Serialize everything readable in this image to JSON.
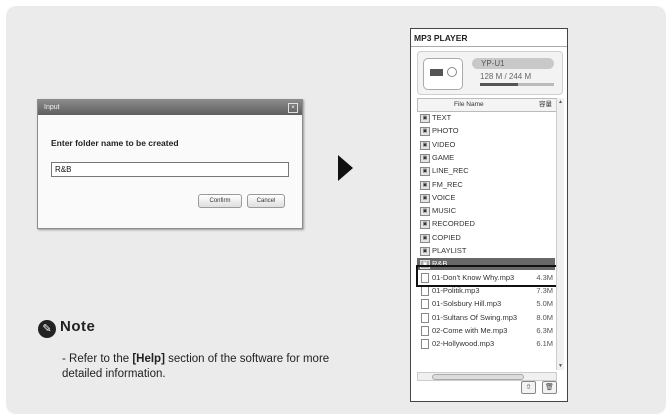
{
  "dialog": {
    "title": "Input",
    "close_label": "×",
    "prompt": "Enter folder name to be created",
    "input_value": "R&B",
    "confirm_label": "Confirm",
    "cancel_label": "Cancel"
  },
  "note": {
    "title": "Note",
    "icon": "pencil-note-icon",
    "text_prefix": "- Refer to the ",
    "text_bold": "[Help]",
    "text_suffix": " section of the software for more detailed information."
  },
  "player": {
    "title": "MP3 PLAYER",
    "device_name": "YP-U1",
    "capacity": "128 M / 244 M",
    "usage_fraction": 0.52,
    "col_name": "File Name",
    "col_size": "容量",
    "rows": [
      {
        "type": "folder",
        "name": "TEXT",
        "size": ""
      },
      {
        "type": "folder",
        "name": "PHOTO",
        "size": ""
      },
      {
        "type": "folder",
        "name": "VIDEO",
        "size": ""
      },
      {
        "type": "folder",
        "name": "GAME",
        "size": ""
      },
      {
        "type": "folder",
        "name": "LINE_REC",
        "size": ""
      },
      {
        "type": "folder",
        "name": "FM_REC",
        "size": ""
      },
      {
        "type": "folder",
        "name": "VOICE",
        "size": ""
      },
      {
        "type": "folder",
        "name": "MUSIC",
        "size": ""
      },
      {
        "type": "folder",
        "name": "RECORDED",
        "size": ""
      },
      {
        "type": "folder",
        "name": "COPIED",
        "size": ""
      },
      {
        "type": "folder",
        "name": "PLAYLIST",
        "size": ""
      },
      {
        "type": "folder",
        "name": "R&B",
        "size": "",
        "selected": true
      },
      {
        "type": "file",
        "name": "01-Don't Know Why.mp3",
        "size": "4.3M"
      },
      {
        "type": "file",
        "name": "01-Politik.mp3",
        "size": "7.3M"
      },
      {
        "type": "file",
        "name": "01-Solsbury Hill.mp3",
        "size": "5.0M"
      },
      {
        "type": "file",
        "name": "01-Sultans Of Swing.mp3",
        "size": "8.0M"
      },
      {
        "type": "file",
        "name": "02-Come with Me.mp3",
        "size": "6.3M"
      },
      {
        "type": "file",
        "name": "02-Hollywood.mp3",
        "size": "6.1M"
      }
    ]
  }
}
